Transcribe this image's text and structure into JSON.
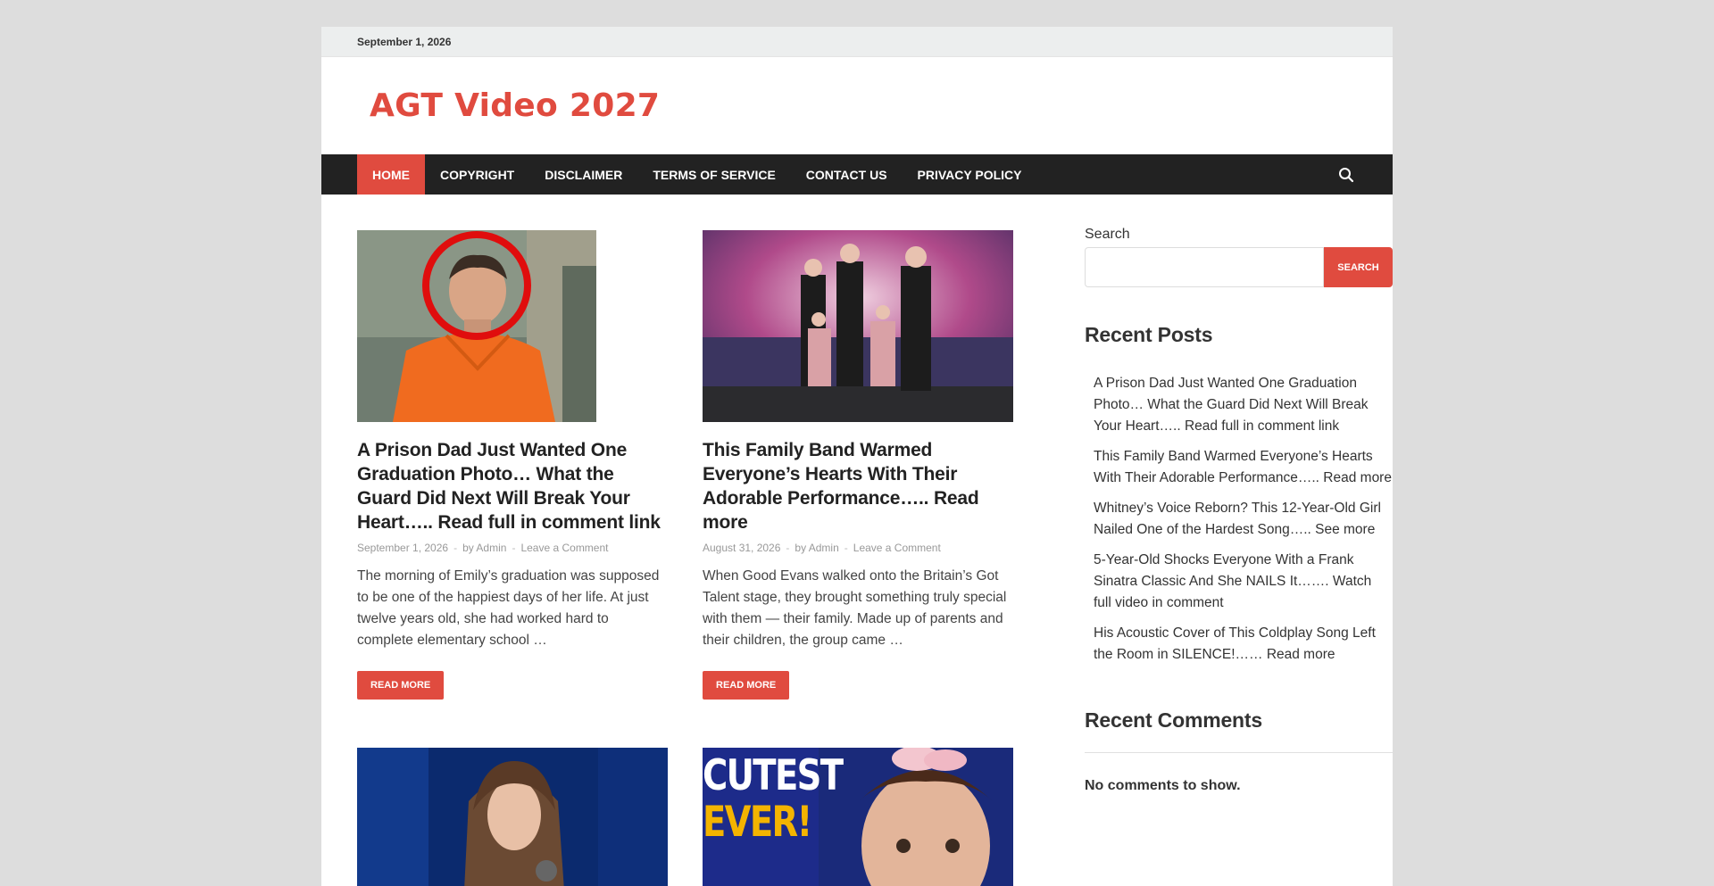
{
  "topbar": {
    "date": "September 1, 2026"
  },
  "site": {
    "title": "AGT Video 2027"
  },
  "nav": {
    "items": [
      {
        "label": "HOME"
      },
      {
        "label": "COPYRIGHT"
      },
      {
        "label": "DISCLAIMER"
      },
      {
        "label": "TERMS OF SERVICE"
      },
      {
        "label": "CONTACT US"
      },
      {
        "label": "PRIVACY POLICY"
      }
    ],
    "search_icon": "search-icon"
  },
  "posts": [
    {
      "title": "A Prison Dad Just Wanted One Graduation Photo… What the Guard Did Next Will Break Your Heart….. Read full in comment link",
      "date": "September 1, 2026",
      "author": "by Admin",
      "comments": "Leave a Comment",
      "excerpt": "The morning of Emily’s graduation was supposed to be one of the happiest days of her life. At just twelve years old, she had worked hard to complete elementary school …",
      "button": "READ MORE"
    },
    {
      "title": "This Family Band Warmed Everyone’s Hearts With Their Adorable Performance….. Read more",
      "date": "August 31, 2026",
      "author": "by Admin",
      "comments": "Leave a Comment",
      "excerpt": "When Good Evans walked onto the Britain’s Got Talent stage, they brought something truly special with them — their family. Made up of parents and their children, the group came …",
      "button": "READ MORE"
    },
    {
      "thumb_text_1": "CUTEST",
      "thumb_text_2": "EVER!"
    }
  ],
  "sidebar": {
    "search_label": "Search",
    "search_button": "SEARCH",
    "recent_posts_title": "Recent Posts",
    "recent_posts": [
      "A Prison Dad Just Wanted One Graduation Photo… What the Guard Did Next Will Break Your Heart….. Read full in comment link",
      "This Family Band Warmed Everyone’s Hearts With Their Adorable Performance….. Read more",
      "Whitney’s Voice Reborn? This 12-Year-Old Girl Nailed One of the Hardest Song….. See more",
      "5-Year-Old Shocks Everyone With a Frank Sinatra Classic And She NAILS It……. Watch full video in comment",
      "His Acoustic Cover of This Coldplay Song Left the Room in SILENCE!…… Read more"
    ],
    "recent_comments_title": "Recent Comments",
    "no_comments": "No comments to show."
  },
  "colors": {
    "accent": "#e04b3f",
    "nav_bg": "#222222",
    "page_bg": "#dddddd"
  }
}
